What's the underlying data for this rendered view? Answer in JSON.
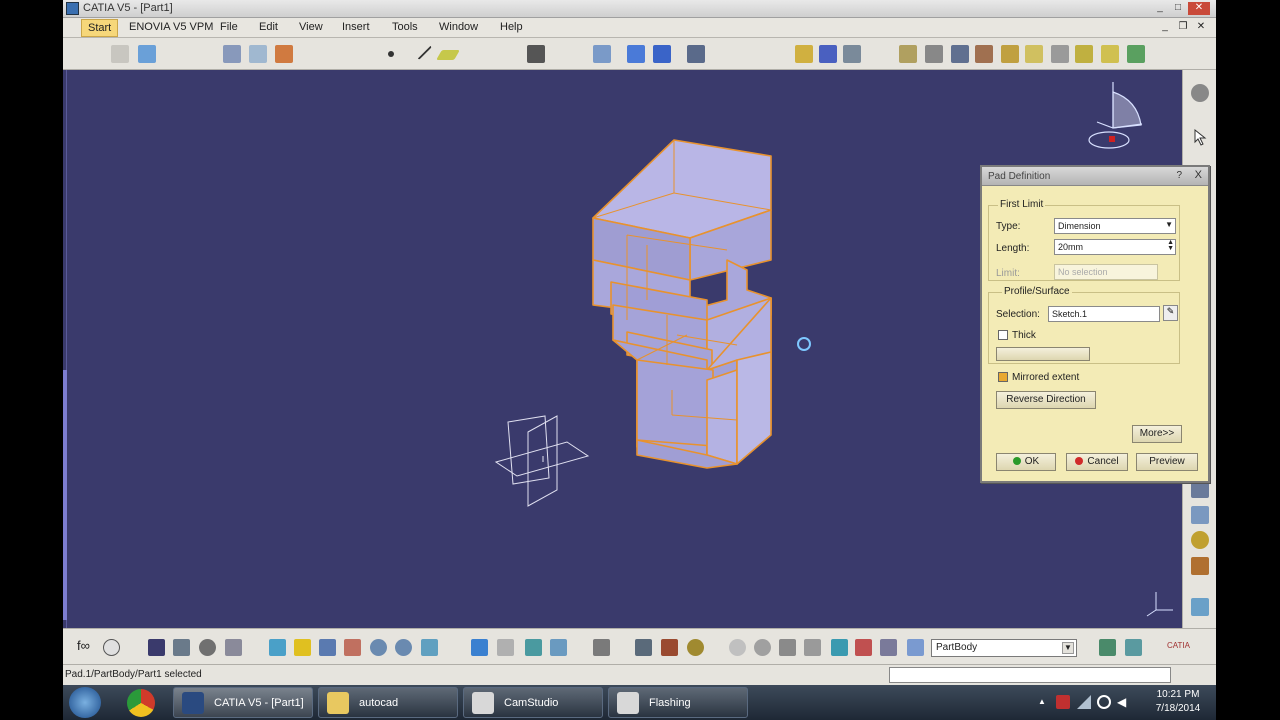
{
  "window": {
    "title": "CATIA V5 - [Part1]"
  },
  "menu": {
    "items": [
      "Start",
      "ENOVIA V5 VPM",
      "File",
      "Edit",
      "View",
      "Insert",
      "Tools",
      "Window",
      "Help"
    ]
  },
  "dialog": {
    "title": "Pad Definition",
    "help": "?",
    "close": "X",
    "first_limit": {
      "group_label": "First Limit",
      "type_label": "Type:",
      "type_value": "Dimension",
      "length_label": "Length:",
      "length_value": "20mm",
      "limit_label": "Limit:",
      "limit_value": "No selection"
    },
    "profile": {
      "group_label": "Profile/Surface",
      "selection_label": "Selection:",
      "selection_value": "Sketch.1",
      "thick_label": "Thick"
    },
    "mirrored_label": "Mirrored extent",
    "mirrored_checked": true,
    "reverse_label": "Reverse Direction",
    "more_label": "More>>",
    "ok_label": "OK",
    "cancel_label": "Cancel",
    "preview_label": "Preview"
  },
  "bottom": {
    "partbody": "PartBody"
  },
  "status": {
    "text": "Pad.1/PartBody/Part1 selected"
  },
  "taskbar": {
    "items": [
      {
        "label": "CATIA V5 - [Part1]"
      },
      {
        "label": "autocad"
      },
      {
        "label": "CamStudio"
      },
      {
        "label": "Flashing"
      }
    ],
    "time": "10:21 PM",
    "date": "7/18/2014"
  },
  "colors": {
    "viewport_bg": "#3a3a6c",
    "dialog_bg": "#f3ebb6",
    "selection_edge": "#e8922e",
    "part_face": "#b9b6e6"
  }
}
